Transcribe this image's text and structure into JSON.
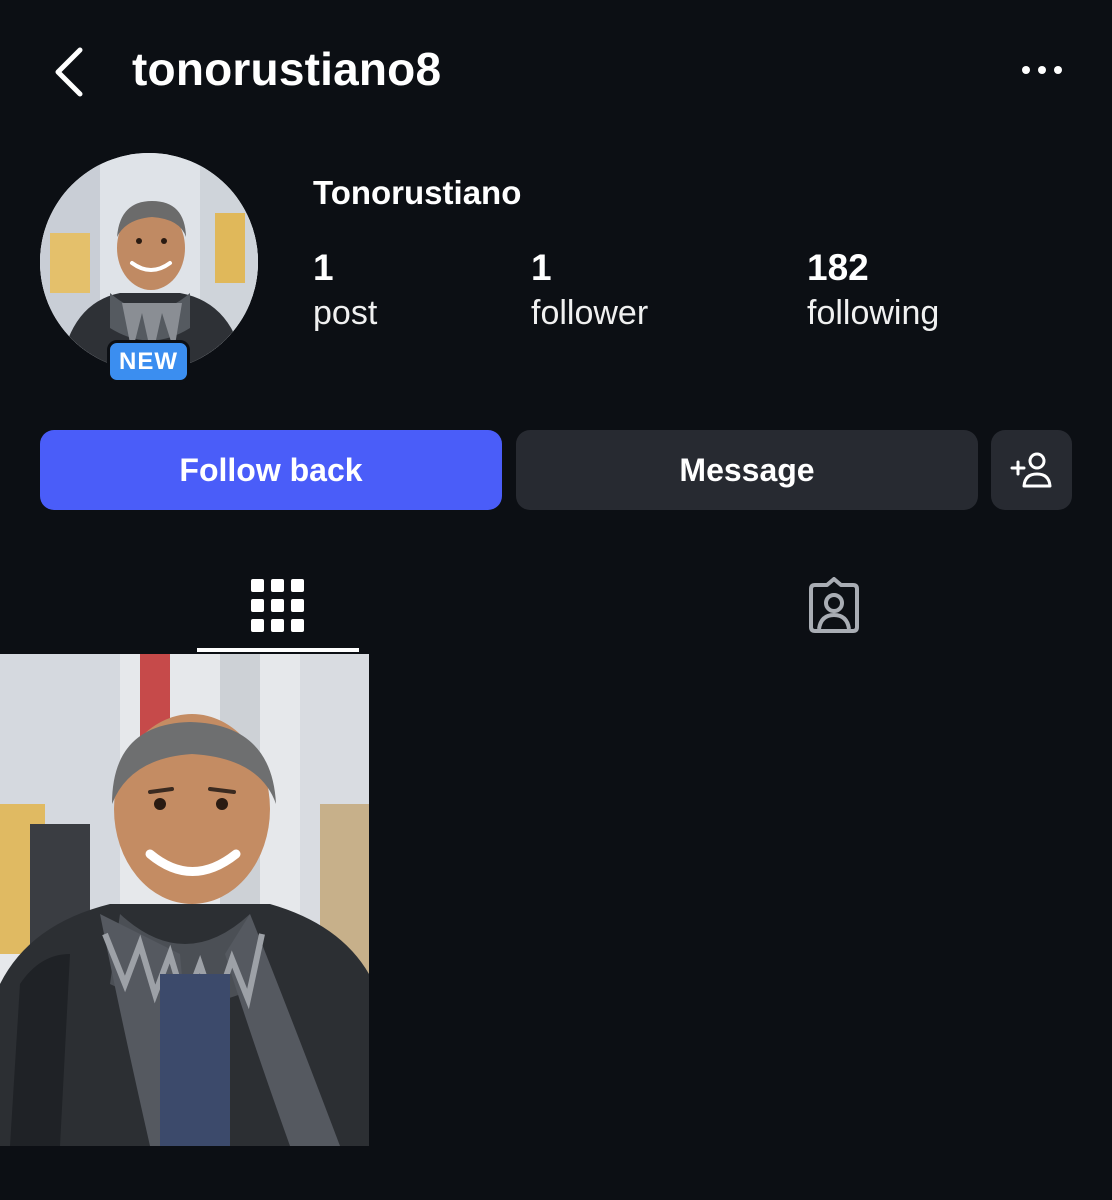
{
  "header": {
    "username": "tonorustiano8",
    "back_icon": "chevron-left-icon",
    "more_icon": "more-horizontal-icon"
  },
  "profile": {
    "display_name": "Tonorustiano",
    "badge": "NEW",
    "stats": {
      "posts": {
        "value": "1",
        "label": "post"
      },
      "followers": {
        "value": "1",
        "label": "follower"
      },
      "following": {
        "value": "182",
        "label": "following"
      }
    }
  },
  "actions": {
    "follow_label": "Follow back",
    "message_label": "Message",
    "suggest_icon": "add-person-icon"
  },
  "tabs": [
    {
      "name": "posts-grid",
      "icon": "grid-icon",
      "active": true
    },
    {
      "name": "tagged",
      "icon": "tagged-person-icon",
      "active": false
    }
  ],
  "posts": [
    {
      "type": "photo"
    }
  ],
  "colors": {
    "background": "#0c0f14",
    "primary_button": "#4a5df9",
    "secondary_button": "#272a31",
    "badge": "#3b8ef0"
  }
}
